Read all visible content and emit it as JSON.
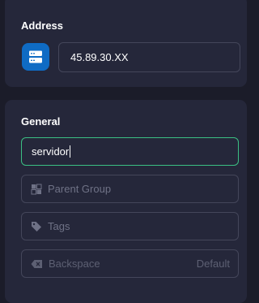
{
  "address": {
    "title": "Address",
    "icon": "server-icon",
    "value": "45.89.30.XX"
  },
  "general": {
    "title": "General",
    "name_value": "servidor",
    "parent_group": {
      "placeholder": "Parent Group",
      "icon": "group-icon"
    },
    "tags": {
      "placeholder": "Tags",
      "icon": "tag-icon"
    },
    "backspace": {
      "placeholder": "Backspace",
      "default_label": "Default",
      "icon": "backspace-icon"
    }
  },
  "colors": {
    "background": "#1b1c29",
    "card": "#25273a",
    "accent_blue": "#0f6bc4",
    "focus_green": "#3bbf83"
  }
}
